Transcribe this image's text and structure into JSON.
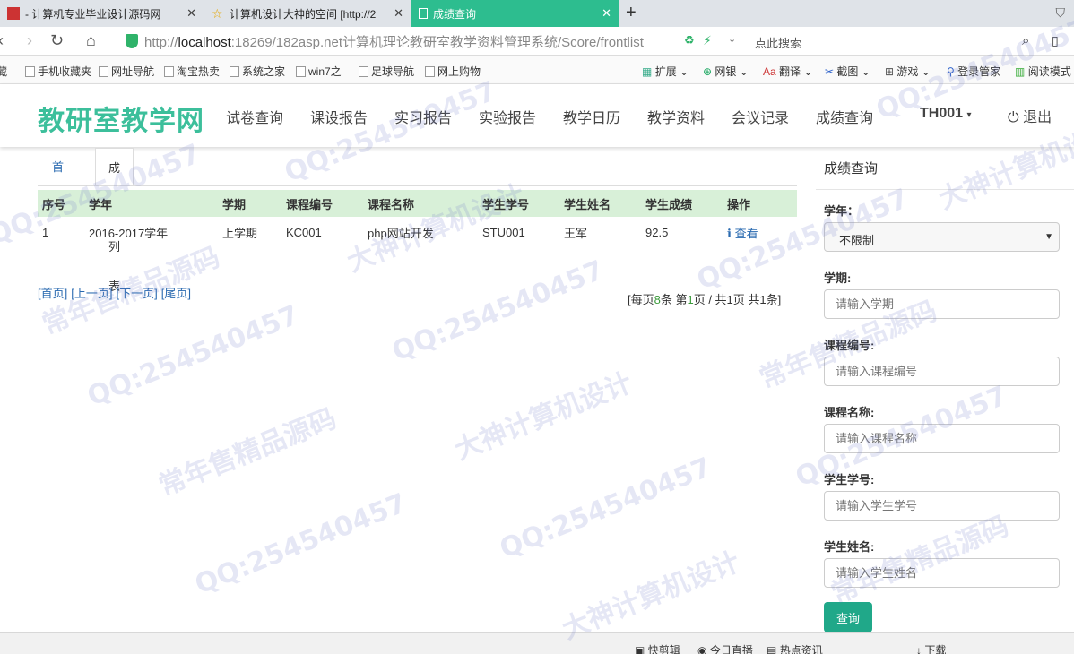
{
  "browser": {
    "tabs": [
      {
        "title": "- 计算机专业毕业设计源码网"
      },
      {
        "title": "计算机设计大神的空间 [http://2"
      },
      {
        "title": "成绩查询"
      }
    ],
    "url_prefix": "http://",
    "url_host": "localhost",
    "url_rest": ":18269/182asp.net计算机理论教研室教学资料管理系统/Score/frontlist",
    "search_hint": "点此搜索",
    "bookmarks": [
      "手机收藏夹",
      "网址导航",
      "淘宝热卖",
      "系统之家",
      "win7之",
      "足球导航",
      "网上购物"
    ],
    "toolbar_right": [
      "扩展",
      "网银",
      "翻译",
      "截图",
      "游戏",
      "登录管家",
      "阅读模式"
    ],
    "status_items": [
      "快剪辑",
      "今日直播",
      "热点资讯",
      "下载"
    ]
  },
  "site": {
    "logo": "教研室教学网",
    "nav": [
      "试卷查询",
      "课设报告",
      "实习报告",
      "实验报告",
      "教学日历",
      "教学资料",
      "会议记录",
      "成绩查询"
    ],
    "user": "TH001",
    "logout": "退出"
  },
  "content": {
    "tab_home": "首页",
    "tab_list": "成绩列表",
    "table": {
      "headers": [
        "序号",
        "学年",
        "学期",
        "课程编号",
        "课程名称",
        "学生学号",
        "学生姓名",
        "学生成绩",
        "操作"
      ],
      "rows": [
        [
          "1",
          "2016-2017学年",
          "上学期",
          "KC001",
          "php网站开发",
          "STU001",
          "王军",
          "92.5",
          "查看"
        ]
      ]
    },
    "pager": {
      "first": "[首页]",
      "prev": "[上一页]",
      "next": "[下一页]",
      "last": "[尾页]",
      "info_prefix": "[每页",
      "per_page": "8",
      "info_mid1": "条 第",
      "page": "1",
      "info_rest": "页 / 共1页 共1条]"
    }
  },
  "search_panel": {
    "title": "成绩查询",
    "year_label": "学年：",
    "year_value": "不限制",
    "term_label": "学期:",
    "term_placeholder": "请输入学期",
    "course_no_label": "课程编号:",
    "course_no_placeholder": "请输入课程编号",
    "course_name_label": "课程名称:",
    "course_name_placeholder": "请输入课程名称",
    "student_no_label": "学生学号:",
    "student_no_placeholder": "请输入学生学号",
    "student_name_label": "学生姓名:",
    "student_name_placeholder": "请输入学生姓名",
    "query_button": "查询"
  },
  "watermarks": [
    "QQ:254540457",
    "常年售精品源码",
    "大神计算机设计"
  ]
}
